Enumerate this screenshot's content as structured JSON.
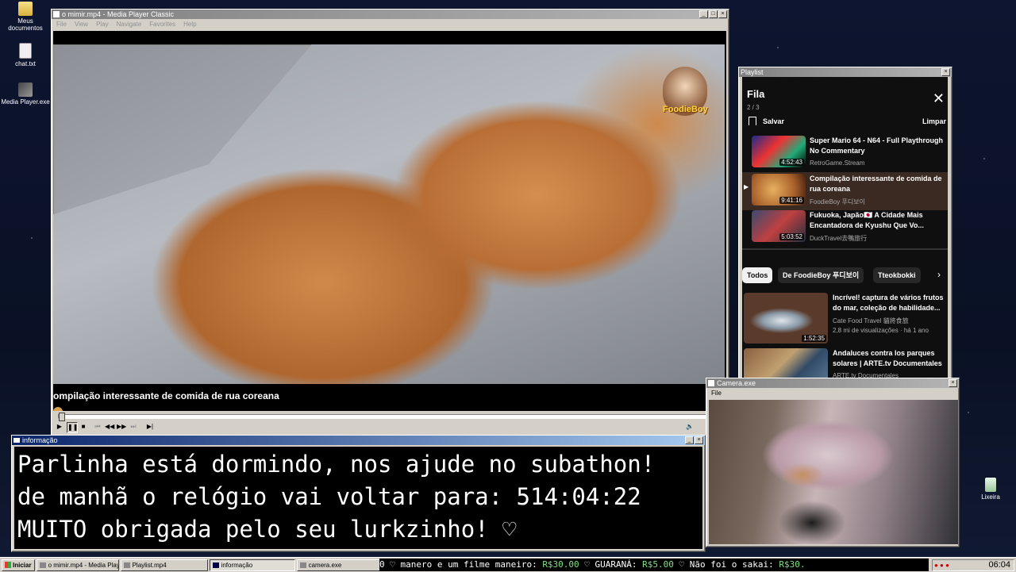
{
  "desktop": {
    "icons": [
      {
        "label": "Meus documentos",
        "icon": "folder-icon"
      },
      {
        "label": "chat.txt",
        "icon": "text-file-icon"
      },
      {
        "label": "Media Player.exe",
        "icon": "media-player-icon"
      }
    ],
    "recycle": {
      "label": "Lixeira",
      "icon": "recycle-bin-icon"
    }
  },
  "player": {
    "title": "o mimir.mp4 - Media Player Classic",
    "menu": [
      "File",
      "View",
      "Play",
      "Navigate",
      "Favorites",
      "Help"
    ],
    "video_title": "ompilação interessante de comida de rua coreana",
    "logo": "FoodieBoy"
  },
  "playlist": {
    "window_title": "Playlist",
    "header": "Fila",
    "position": "2 / 3",
    "save": "Salvar",
    "clear": "Limpar",
    "items": [
      {
        "title": "Super Mario 64 - N64 - Full Playthrough No Commentary",
        "channel": "RetroGame.Stream",
        "duration": "4:52:43"
      },
      {
        "title": "Compilação interessante de comida de rua coreana",
        "channel": "FoodieBoy 푸디보이",
        "duration": "9:41:16"
      },
      {
        "title": "Fukuoka, Japão🇯🇵 A Cidade Mais Encantadora de Kyushu Que Vo...",
        "channel": "DuckTravel去鴨旅行",
        "duration": "5:03:52"
      }
    ],
    "chips": [
      "Todos",
      "De FoodieBoy 푸디보이",
      "Tteokbokki"
    ],
    "recs": [
      {
        "title": "Incrível! captura de vários frutos do mar, coleção de habilidade...",
        "channel": "Cate Food Travel 貓將食旅",
        "meta": "2,8 mi de visualizações · há 1 ano",
        "duration": "1:52:35"
      },
      {
        "title": "Andaluces contra los parques solares | ARTE.tv Documentales",
        "channel": "ARTE.tv Documentales",
        "meta": "",
        "duration": ""
      }
    ]
  },
  "info": {
    "title": "informação",
    "lines": [
      "Parlinha está dormindo, nos ajude no subathon!",
      "de manhã o relógio vai voltar para:  514:04:22",
      "MUITO obrigada pelo seu lurkzinho! ♡"
    ]
  },
  "camera": {
    "title": "Camera.exe",
    "menu": "File"
  },
  "taskbar": {
    "start": "Iniciar",
    "buttons": [
      "o mimir.mp4 - Media Playe...",
      "Playlist.mp4",
      "informação",
      "camera.exe"
    ],
    "ticker_parts": [
      "0 ♡",
      "manero e um filme maneiro:",
      "R$30.00",
      "♡",
      "GUARANÁ:",
      "R$5.00",
      "♡",
      "Não foi o sakai:",
      "R$30."
    ],
    "clock": "06:04"
  }
}
